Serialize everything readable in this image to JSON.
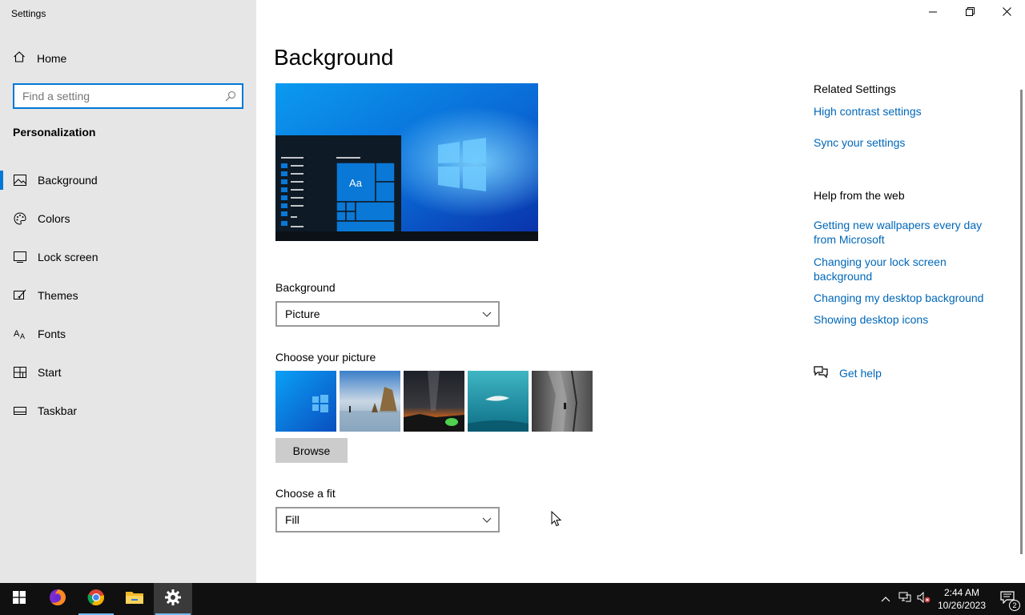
{
  "window": {
    "title": "Settings"
  },
  "sidebar": {
    "home_label": "Home",
    "search_placeholder": "Find a setting",
    "section_title": "Personalization",
    "items": [
      {
        "label": "Background",
        "icon": "picture-icon",
        "active": true
      },
      {
        "label": "Colors",
        "icon": "palette-icon"
      },
      {
        "label": "Lock screen",
        "icon": "lock-screen-icon"
      },
      {
        "label": "Themes",
        "icon": "brush-icon"
      },
      {
        "label": "Fonts",
        "icon": "font-icon"
      },
      {
        "label": "Start",
        "icon": "start-icon"
      },
      {
        "label": "Taskbar",
        "icon": "taskbar-icon"
      }
    ]
  },
  "main": {
    "title": "Background",
    "preview": {
      "tile_text": "Aa"
    },
    "background_label": "Background",
    "background_value": "Picture",
    "choose_picture_label": "Choose your picture",
    "browse_label": "Browse",
    "fit_label": "Choose a fit",
    "fit_value": "Fill"
  },
  "related": {
    "title": "Related Settings",
    "links": [
      "High contrast settings",
      "Sync your settings"
    ]
  },
  "help": {
    "title": "Help from the web",
    "links": [
      "Getting new wallpapers every day from Microsoft",
      "Changing your lock screen background",
      "Changing my desktop background",
      "Showing desktop icons"
    ],
    "get_help": "Get help"
  },
  "taskbar": {
    "time": "2:44 AM",
    "date": "10/26/2023",
    "notification_count": "2"
  },
  "colors": {
    "accent": "#0078d7",
    "link": "#0067b8",
    "sidebar_bg": "#e6e6e6",
    "taskbar_bg": "#101010"
  }
}
